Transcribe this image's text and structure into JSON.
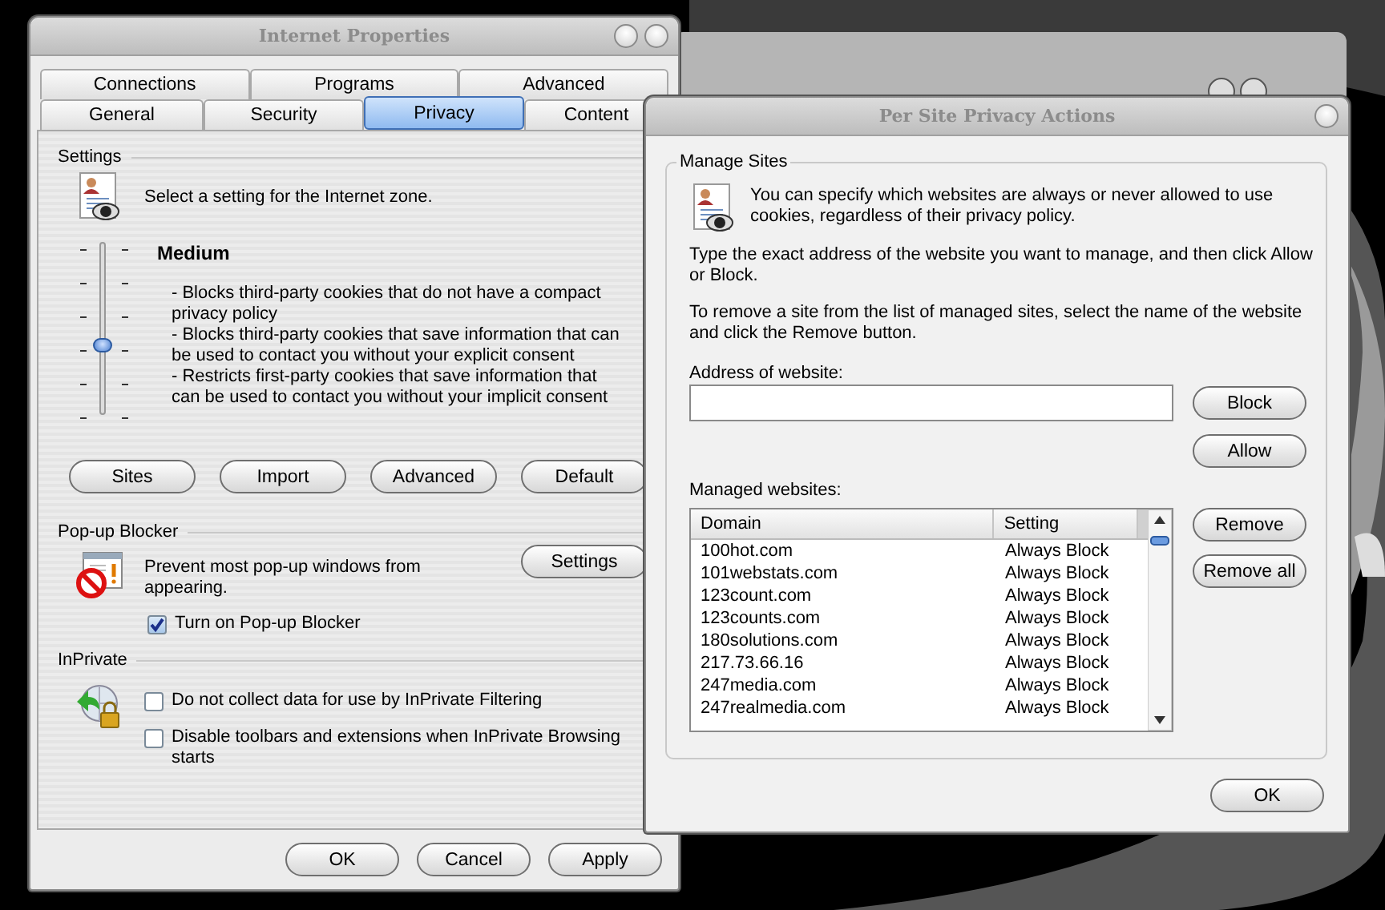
{
  "internet_properties": {
    "title": "Internet Properties",
    "tab_rows": [
      {
        "tabs": [
          {
            "label": "Connections",
            "selected": false
          },
          {
            "label": "Programs",
            "selected": false
          },
          {
            "label": "Advanced",
            "selected": false
          }
        ]
      },
      {
        "tabs": [
          {
            "label": "General",
            "selected": false
          },
          {
            "label": "Security",
            "selected": false
          },
          {
            "label": "Privacy",
            "selected": true
          },
          {
            "label": "Content",
            "selected": false
          }
        ]
      }
    ],
    "settings": {
      "heading": "Settings",
      "intro": "Select a setting for the Internet zone.",
      "slider": {
        "level": 0.4
      },
      "level_name": "Medium",
      "description": [
        "- Blocks third-party cookies that do not have a compact privacy policy",
        "- Blocks third-party cookies that save information that can be used to contact you without your explicit consent",
        "- Restricts first-party cookies that save information that can be used to contact you without your implicit consent"
      ],
      "buttons": [
        "Sites",
        "Import",
        "Advanced",
        "Default"
      ]
    },
    "popup_blocker": {
      "heading": "Pop-up Blocker",
      "text": "Prevent most pop-up windows from appearing.",
      "settings_button": "Settings",
      "checkbox": {
        "label": "Turn on Pop-up Blocker",
        "checked": true
      }
    },
    "inprivate": {
      "heading": "InPrivate",
      "checkboxes": [
        {
          "label": "Do not collect data for use by InPrivate Filtering",
          "checked": false
        },
        {
          "label": "Disable toolbars and extensions when InPrivate Browsing starts",
          "checked": false
        }
      ]
    },
    "buttons": [
      "OK",
      "Cancel",
      "Apply"
    ]
  },
  "per_site": {
    "title": "Per Site Privacy Actions",
    "group": "Manage Sites",
    "intro": "You can specify which websites are always or never allowed to use cookies, regardless of their privacy policy.",
    "instructions": [
      "Type the exact address of the website you want to manage, and then click Allow or Block.",
      "To remove a site from the list of managed sites, select the name of the website and click the Remove button."
    ],
    "address_label": "Address of website:",
    "address_buttons": [
      "Block",
      "Allow"
    ],
    "list_label": "Managed websites:",
    "columns": [
      "Domain",
      "Setting"
    ],
    "rows": [
      {
        "domain": "100hot.com",
        "setting": "Always Block"
      },
      {
        "domain": "101webstats.com",
        "setting": "Always Block"
      },
      {
        "domain": "123count.com",
        "setting": "Always Block"
      },
      {
        "domain": "123counts.com",
        "setting": "Always Block"
      },
      {
        "domain": "180solutions.com",
        "setting": "Always Block"
      },
      {
        "domain": "217.73.66.16",
        "setting": "Always Block"
      },
      {
        "domain": "247media.com",
        "setting": "Always Block"
      },
      {
        "domain": "247realmedia.com",
        "setting": "Always Block"
      }
    ],
    "list_buttons": [
      "Remove",
      "Remove all"
    ],
    "ok_button": "OK"
  }
}
